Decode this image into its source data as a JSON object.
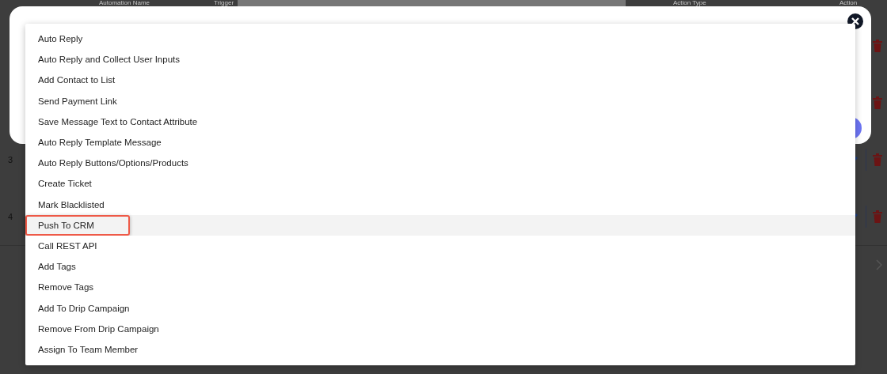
{
  "background_table": {
    "columns": [
      "Automation Name",
      "Trigger",
      "Action Type",
      "Action"
    ],
    "rows": [
      {
        "kind": "covered"
      },
      {
        "kind": "covered"
      },
      {
        "kind": "numbered",
        "number": "3"
      },
      {
        "kind": "numbered",
        "number": "4"
      }
    ]
  },
  "dropdown": {
    "items": [
      {
        "label": "Auto Reply",
        "selected": false,
        "outlined": false
      },
      {
        "label": "Auto Reply and Collect User Inputs",
        "selected": false,
        "outlined": false
      },
      {
        "label": "Add Contact to List",
        "selected": false,
        "outlined": false
      },
      {
        "label": "Send Payment Link",
        "selected": false,
        "outlined": false
      },
      {
        "label": "Save Message Text to Contact Attribute",
        "selected": false,
        "outlined": false
      },
      {
        "label": "Auto Reply Template Message",
        "selected": false,
        "outlined": false
      },
      {
        "label": "Auto Reply Buttons/Options/Products",
        "selected": false,
        "outlined": false
      },
      {
        "label": "Create Ticket",
        "selected": false,
        "outlined": false
      },
      {
        "label": "Mark Blacklisted",
        "selected": false,
        "outlined": false
      },
      {
        "label": "Push To CRM",
        "selected": true,
        "outlined": true
      },
      {
        "label": "Call REST API",
        "selected": false,
        "outlined": false
      },
      {
        "label": "Add Tags",
        "selected": false,
        "outlined": false
      },
      {
        "label": "Remove Tags",
        "selected": false,
        "outlined": false
      },
      {
        "label": "Add To Drip Campaign",
        "selected": false,
        "outlined": false
      },
      {
        "label": "Remove From Drip Campaign",
        "selected": false,
        "outlined": false
      },
      {
        "label": "Assign To Team Member",
        "selected": false,
        "outlined": false
      }
    ]
  }
}
